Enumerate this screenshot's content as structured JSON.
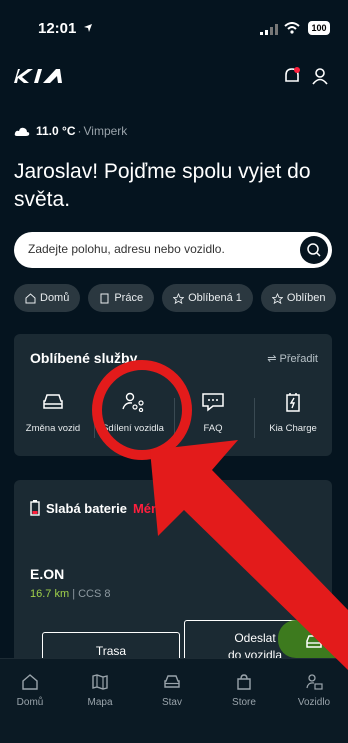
{
  "status": {
    "time": "12:01",
    "battery": "100"
  },
  "brand": {
    "logo_text": "KIA"
  },
  "weather": {
    "temp": "11.0 °C",
    "separator": "·",
    "location": "Vimperk"
  },
  "greeting": "Jaroslav! Pojďme spolu vyjet do světa.",
  "search": {
    "placeholder": "Zadejte polohu, adresu nebo vozidlo."
  },
  "chips": [
    "Domů",
    "Práce",
    "Oblíbená 1",
    "Oblíben"
  ],
  "favorites": {
    "title": "Oblíbené služby",
    "reorder": "⇌ Přeřadit",
    "items": [
      "Změna vozid",
      "Sdílení vozidla",
      "FAQ",
      "Kia Charge"
    ]
  },
  "battery_card": {
    "title": "Slabá baterie",
    "title_red": "Méně",
    "provider": "E.ON",
    "distance": "16.7 km",
    "connector": "| CCS 8",
    "route_button": "Trasa",
    "send_button_line1": "Odeslat",
    "send_button_line2": "do vozidla"
  },
  "tabs": [
    "Domů",
    "Mapa",
    "Stav",
    "Store",
    "Vozidlo"
  ],
  "colors": {
    "background": "#05141f",
    "card": "#1b2a33",
    "accent_green": "#3d7a1e",
    "alert_red": "#ff1f3d",
    "annotation": "#e31b1b"
  },
  "icons": [
    "location-arrow-icon",
    "signal-icon",
    "wifi-icon",
    "battery-icon",
    "notification-bell-icon",
    "user-icon",
    "cloud-icon",
    "search-icon",
    "home-icon",
    "building-icon",
    "star-icon",
    "car-icon",
    "share-users-icon",
    "chat-icon",
    "charger-icon",
    "battery-low-icon",
    "car-wifi-icon",
    "map-icon",
    "store-bag-icon",
    "person-car-icon"
  ]
}
